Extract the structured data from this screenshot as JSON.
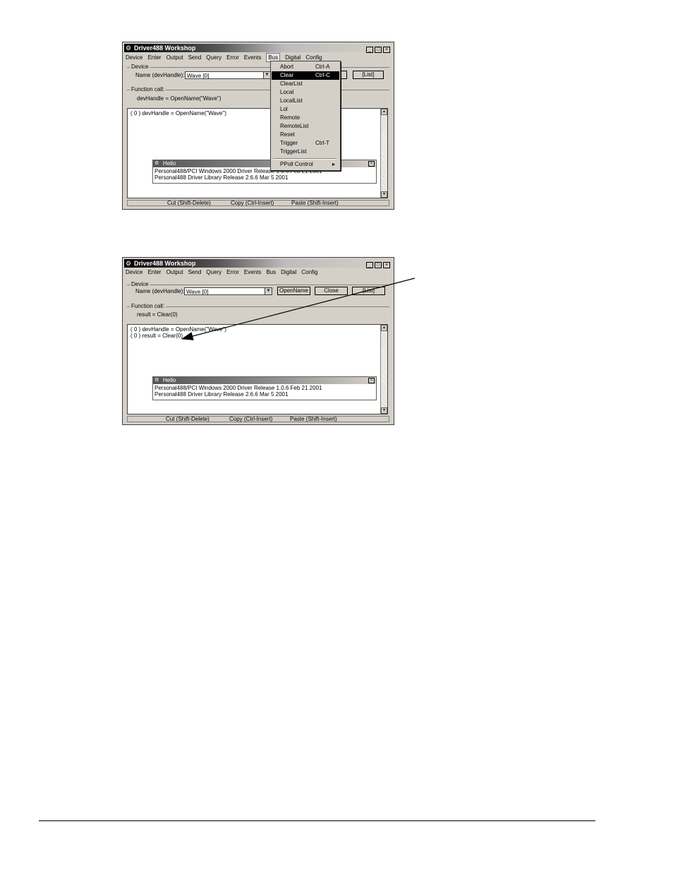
{
  "title_bar": {
    "app_name": "Driver488 Workshop",
    "minimize": "_",
    "maximize": "□",
    "close": "×"
  },
  "menus": [
    "Device",
    "Enter",
    "Output",
    "Send",
    "Query",
    "Error",
    "Events",
    "Bus",
    "Digital",
    "Config"
  ],
  "device_group": {
    "legend": "Device",
    "name_label": "Name (devHandle):",
    "name_value": "Wave  [0]",
    "open_button": "OpenName",
    "close_button": "Close",
    "list_button": "[List]"
  },
  "function_call_group": {
    "legend": "Function call:"
  },
  "bus_menu": {
    "items": [
      {
        "label": "Abort",
        "shortcut": "Ctrl-A"
      },
      {
        "label": "Clear",
        "shortcut": "Ctrl-C"
      },
      {
        "label": "ClearList",
        "shortcut": ""
      },
      {
        "label": "Local",
        "shortcut": ""
      },
      {
        "label": "LocalList",
        "shortcut": ""
      },
      {
        "label": "Lol",
        "shortcut": ""
      },
      {
        "label": "Remote",
        "shortcut": ""
      },
      {
        "label": "RemoteList",
        "shortcut": ""
      },
      {
        "label": "Reset",
        "shortcut": ""
      },
      {
        "label": "Trigger",
        "shortcut": "Ctrl-T"
      },
      {
        "label": "TriggerList",
        "shortcut": ""
      },
      {
        "label": "PPoll Control",
        "shortcut": "▸"
      }
    ]
  },
  "hello_window": {
    "title": "Hello",
    "line1": "Personal488/PCI Windows 2000 Driver Release 1.0.6  Feb 21 2001",
    "line2": "Personal488 Driver Library Release 2.6.6 Mar  5 2001",
    "close": "×"
  },
  "status_bar": {
    "cut": "Cut (Shift-Delete)",
    "copy": "Copy (Ctrl-Insert)",
    "paste": "Paste (Shift-Insert)"
  },
  "screenshot1": {
    "function_call_text": "devHandle = OpenName(\"Wave\")",
    "log_lines": [
      "( 0 )   devHandle = OpenName(\"Wave\")"
    ]
  },
  "screenshot2": {
    "function_call_text": "result = Clear(0)",
    "log_lines": [
      "( 0 )   devHandle = OpenName(\"Wave\")",
      "( 0 )   result = Clear(0)"
    ]
  }
}
